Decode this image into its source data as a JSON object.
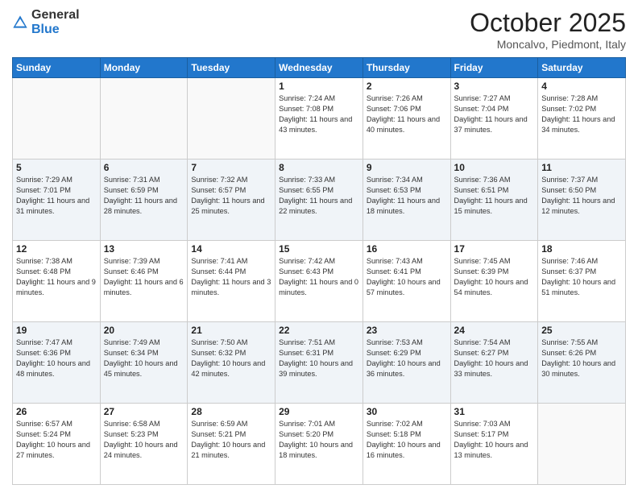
{
  "header": {
    "logo_general": "General",
    "logo_blue": "Blue",
    "title": "October 2025",
    "subtitle": "Moncalvo, Piedmont, Italy"
  },
  "days_of_week": [
    "Sunday",
    "Monday",
    "Tuesday",
    "Wednesday",
    "Thursday",
    "Friday",
    "Saturday"
  ],
  "weeks": [
    [
      {
        "day": "",
        "sunrise": "",
        "sunset": "",
        "daylight": ""
      },
      {
        "day": "",
        "sunrise": "",
        "sunset": "",
        "daylight": ""
      },
      {
        "day": "",
        "sunrise": "",
        "sunset": "",
        "daylight": ""
      },
      {
        "day": "1",
        "sunrise": "Sunrise: 7:24 AM",
        "sunset": "Sunset: 7:08 PM",
        "daylight": "Daylight: 11 hours and 43 minutes."
      },
      {
        "day": "2",
        "sunrise": "Sunrise: 7:26 AM",
        "sunset": "Sunset: 7:06 PM",
        "daylight": "Daylight: 11 hours and 40 minutes."
      },
      {
        "day": "3",
        "sunrise": "Sunrise: 7:27 AM",
        "sunset": "Sunset: 7:04 PM",
        "daylight": "Daylight: 11 hours and 37 minutes."
      },
      {
        "day": "4",
        "sunrise": "Sunrise: 7:28 AM",
        "sunset": "Sunset: 7:02 PM",
        "daylight": "Daylight: 11 hours and 34 minutes."
      }
    ],
    [
      {
        "day": "5",
        "sunrise": "Sunrise: 7:29 AM",
        "sunset": "Sunset: 7:01 PM",
        "daylight": "Daylight: 11 hours and 31 minutes."
      },
      {
        "day": "6",
        "sunrise": "Sunrise: 7:31 AM",
        "sunset": "Sunset: 6:59 PM",
        "daylight": "Daylight: 11 hours and 28 minutes."
      },
      {
        "day": "7",
        "sunrise": "Sunrise: 7:32 AM",
        "sunset": "Sunset: 6:57 PM",
        "daylight": "Daylight: 11 hours and 25 minutes."
      },
      {
        "day": "8",
        "sunrise": "Sunrise: 7:33 AM",
        "sunset": "Sunset: 6:55 PM",
        "daylight": "Daylight: 11 hours and 22 minutes."
      },
      {
        "day": "9",
        "sunrise": "Sunrise: 7:34 AM",
        "sunset": "Sunset: 6:53 PM",
        "daylight": "Daylight: 11 hours and 18 minutes."
      },
      {
        "day": "10",
        "sunrise": "Sunrise: 7:36 AM",
        "sunset": "Sunset: 6:51 PM",
        "daylight": "Daylight: 11 hours and 15 minutes."
      },
      {
        "day": "11",
        "sunrise": "Sunrise: 7:37 AM",
        "sunset": "Sunset: 6:50 PM",
        "daylight": "Daylight: 11 hours and 12 minutes."
      }
    ],
    [
      {
        "day": "12",
        "sunrise": "Sunrise: 7:38 AM",
        "sunset": "Sunset: 6:48 PM",
        "daylight": "Daylight: 11 hours and 9 minutes."
      },
      {
        "day": "13",
        "sunrise": "Sunrise: 7:39 AM",
        "sunset": "Sunset: 6:46 PM",
        "daylight": "Daylight: 11 hours and 6 minutes."
      },
      {
        "day": "14",
        "sunrise": "Sunrise: 7:41 AM",
        "sunset": "Sunset: 6:44 PM",
        "daylight": "Daylight: 11 hours and 3 minutes."
      },
      {
        "day": "15",
        "sunrise": "Sunrise: 7:42 AM",
        "sunset": "Sunset: 6:43 PM",
        "daylight": "Daylight: 11 hours and 0 minutes."
      },
      {
        "day": "16",
        "sunrise": "Sunrise: 7:43 AM",
        "sunset": "Sunset: 6:41 PM",
        "daylight": "Daylight: 10 hours and 57 minutes."
      },
      {
        "day": "17",
        "sunrise": "Sunrise: 7:45 AM",
        "sunset": "Sunset: 6:39 PM",
        "daylight": "Daylight: 10 hours and 54 minutes."
      },
      {
        "day": "18",
        "sunrise": "Sunrise: 7:46 AM",
        "sunset": "Sunset: 6:37 PM",
        "daylight": "Daylight: 10 hours and 51 minutes."
      }
    ],
    [
      {
        "day": "19",
        "sunrise": "Sunrise: 7:47 AM",
        "sunset": "Sunset: 6:36 PM",
        "daylight": "Daylight: 10 hours and 48 minutes."
      },
      {
        "day": "20",
        "sunrise": "Sunrise: 7:49 AM",
        "sunset": "Sunset: 6:34 PM",
        "daylight": "Daylight: 10 hours and 45 minutes."
      },
      {
        "day": "21",
        "sunrise": "Sunrise: 7:50 AM",
        "sunset": "Sunset: 6:32 PM",
        "daylight": "Daylight: 10 hours and 42 minutes."
      },
      {
        "day": "22",
        "sunrise": "Sunrise: 7:51 AM",
        "sunset": "Sunset: 6:31 PM",
        "daylight": "Daylight: 10 hours and 39 minutes."
      },
      {
        "day": "23",
        "sunrise": "Sunrise: 7:53 AM",
        "sunset": "Sunset: 6:29 PM",
        "daylight": "Daylight: 10 hours and 36 minutes."
      },
      {
        "day": "24",
        "sunrise": "Sunrise: 7:54 AM",
        "sunset": "Sunset: 6:27 PM",
        "daylight": "Daylight: 10 hours and 33 minutes."
      },
      {
        "day": "25",
        "sunrise": "Sunrise: 7:55 AM",
        "sunset": "Sunset: 6:26 PM",
        "daylight": "Daylight: 10 hours and 30 minutes."
      }
    ],
    [
      {
        "day": "26",
        "sunrise": "Sunrise: 6:57 AM",
        "sunset": "Sunset: 5:24 PM",
        "daylight": "Daylight: 10 hours and 27 minutes."
      },
      {
        "day": "27",
        "sunrise": "Sunrise: 6:58 AM",
        "sunset": "Sunset: 5:23 PM",
        "daylight": "Daylight: 10 hours and 24 minutes."
      },
      {
        "day": "28",
        "sunrise": "Sunrise: 6:59 AM",
        "sunset": "Sunset: 5:21 PM",
        "daylight": "Daylight: 10 hours and 21 minutes."
      },
      {
        "day": "29",
        "sunrise": "Sunrise: 7:01 AM",
        "sunset": "Sunset: 5:20 PM",
        "daylight": "Daylight: 10 hours and 18 minutes."
      },
      {
        "day": "30",
        "sunrise": "Sunrise: 7:02 AM",
        "sunset": "Sunset: 5:18 PM",
        "daylight": "Daylight: 10 hours and 16 minutes."
      },
      {
        "day": "31",
        "sunrise": "Sunrise: 7:03 AM",
        "sunset": "Sunset: 5:17 PM",
        "daylight": "Daylight: 10 hours and 13 minutes."
      },
      {
        "day": "",
        "sunrise": "",
        "sunset": "",
        "daylight": ""
      }
    ]
  ]
}
